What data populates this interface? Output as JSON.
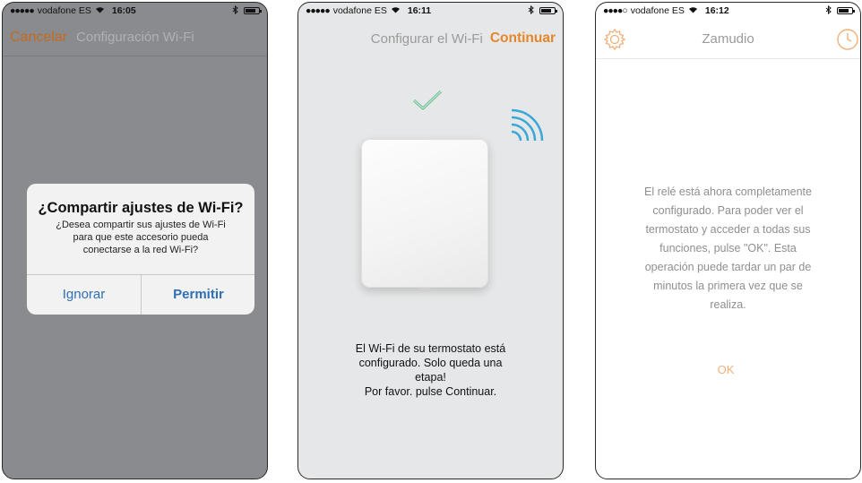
{
  "screens": [
    {
      "status": {
        "carrier": "vodafone ES",
        "time": "16:05",
        "signal_dots": "●●●●●"
      },
      "nav": {
        "cancel": "Cancelar",
        "title": "Configuración Wi-Fi"
      },
      "alert": {
        "title": "¿Compartir ajustes de Wi-Fi?",
        "message_lines": [
          "¿Desea compartir sus ajustes de Wi-Fi",
          "para que este accesorio pueda",
          "conectarse a la red Wi-Fi?"
        ],
        "ignore": "Ignorar",
        "allow": "Permitir"
      }
    },
    {
      "status": {
        "carrier": "vodafone ES",
        "time": "16:11",
        "signal_dots": "●●●●●"
      },
      "nav": {
        "title": "Configurar el Wi-Fi",
        "continue": "Continuar"
      },
      "message_lines": [
        "El Wi-Fi de su termostato está",
        "configurado. Solo queda una",
        "etapa!",
        "Por favor. pulse Continuar."
      ]
    },
    {
      "status": {
        "carrier": "vodafone ES",
        "time": "16:12",
        "signal_dots": "●●●●○"
      },
      "nav": {
        "title": "Zamudio"
      },
      "message_lines": [
        "El relé está ahora completamente",
        "configurado. Para poder ver el",
        "termostato y acceder a todas sus",
        "funciones, pulse \"OK\". Esta",
        "operación puede tardar un par de",
        "minutos la primera vez que se",
        "realiza."
      ],
      "ok": "OK"
    }
  ],
  "colors": {
    "accent_orange": "#e5862a",
    "cancel_orange": "#c46a1e",
    "alert_blue": "#2f6fb5",
    "check_green": "#5fbf8f",
    "wifi_blue": "#3aa7d9",
    "icon_orange": "#f0b07a"
  },
  "icons": [
    "wifi-icon",
    "bluetooth-icon",
    "battery-icon",
    "check-icon",
    "wifi-signal-icon",
    "gear-icon",
    "clock-icon"
  ]
}
